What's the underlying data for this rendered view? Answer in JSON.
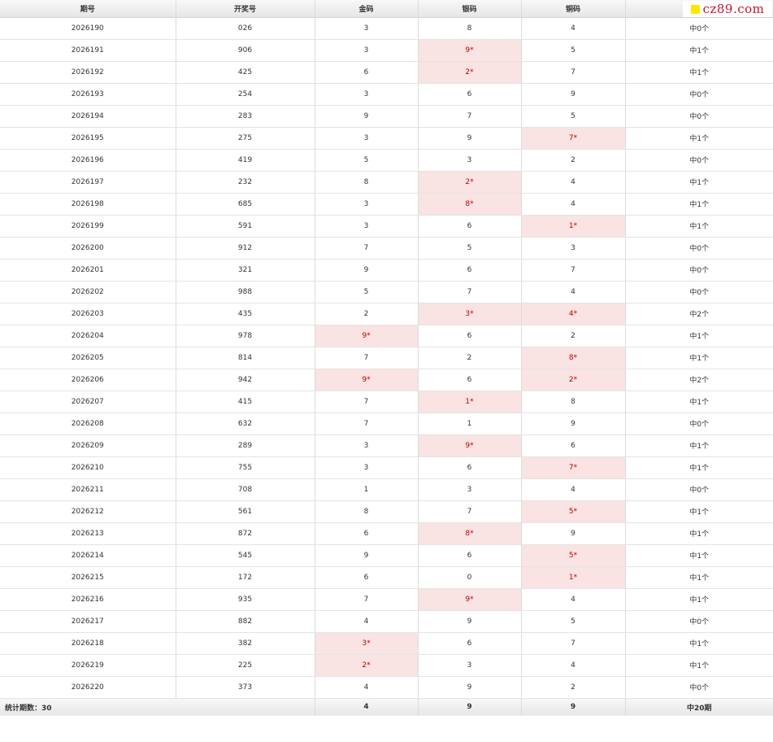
{
  "headers": [
    "期号",
    "开奖号",
    "金码",
    "银码",
    "铜码",
    ""
  ],
  "logo": {
    "text": "cz89.com",
    "color": "#c8102e",
    "square_color": "#ffe600"
  },
  "hit_color": "#fae3e3",
  "rows": [
    {
      "issue": "2026190",
      "number": "026",
      "gold": "3",
      "silver": "8",
      "bronze": "4",
      "hits": [],
      "result": "中0个"
    },
    {
      "issue": "2026191",
      "number": "906",
      "gold": "3",
      "silver": "9*",
      "bronze": "5",
      "hits": [
        "silver"
      ],
      "result": "中1个"
    },
    {
      "issue": "2026192",
      "number": "425",
      "gold": "6",
      "silver": "2*",
      "bronze": "7",
      "hits": [
        "silver"
      ],
      "result": "中1个"
    },
    {
      "issue": "2026193",
      "number": "254",
      "gold": "3",
      "silver": "6",
      "bronze": "9",
      "hits": [],
      "result": "中0个"
    },
    {
      "issue": "2026194",
      "number": "283",
      "gold": "9",
      "silver": "7",
      "bronze": "5",
      "hits": [],
      "result": "中0个"
    },
    {
      "issue": "2026195",
      "number": "275",
      "gold": "3",
      "silver": "9",
      "bronze": "7*",
      "hits": [
        "bronze"
      ],
      "result": "中1个"
    },
    {
      "issue": "2026196",
      "number": "419",
      "gold": "5",
      "silver": "3",
      "bronze": "2",
      "hits": [],
      "result": "中0个"
    },
    {
      "issue": "2026197",
      "number": "232",
      "gold": "8",
      "silver": "2*",
      "bronze": "4",
      "hits": [
        "silver"
      ],
      "result": "中1个"
    },
    {
      "issue": "2026198",
      "number": "685",
      "gold": "3",
      "silver": "8*",
      "bronze": "4",
      "hits": [
        "silver"
      ],
      "result": "中1个"
    },
    {
      "issue": "2026199",
      "number": "591",
      "gold": "3",
      "silver": "6",
      "bronze": "1*",
      "hits": [
        "bronze"
      ],
      "result": "中1个"
    },
    {
      "issue": "2026200",
      "number": "912",
      "gold": "7",
      "silver": "5",
      "bronze": "3",
      "hits": [],
      "result": "中0个"
    },
    {
      "issue": "2026201",
      "number": "321",
      "gold": "9",
      "silver": "6",
      "bronze": "7",
      "hits": [],
      "result": "中0个"
    },
    {
      "issue": "2026202",
      "number": "988",
      "gold": "5",
      "silver": "7",
      "bronze": "4",
      "hits": [],
      "result": "中0个"
    },
    {
      "issue": "2026203",
      "number": "435",
      "gold": "2",
      "silver": "3*",
      "bronze": "4*",
      "hits": [
        "silver",
        "bronze"
      ],
      "result": "中2个"
    },
    {
      "issue": "2026204",
      "number": "978",
      "gold": "9*",
      "silver": "6",
      "bronze": "2",
      "hits": [
        "gold"
      ],
      "result": "中1个"
    },
    {
      "issue": "2026205",
      "number": "814",
      "gold": "7",
      "silver": "2",
      "bronze": "8*",
      "hits": [
        "bronze"
      ],
      "result": "中1个"
    },
    {
      "issue": "2026206",
      "number": "942",
      "gold": "9*",
      "silver": "6",
      "bronze": "2*",
      "hits": [
        "gold",
        "bronze"
      ],
      "result": "中2个"
    },
    {
      "issue": "2026207",
      "number": "415",
      "gold": "7",
      "silver": "1*",
      "bronze": "8",
      "hits": [
        "silver"
      ],
      "result": "中1个"
    },
    {
      "issue": "2026208",
      "number": "632",
      "gold": "7",
      "silver": "1",
      "bronze": "9",
      "hits": [],
      "result": "中0个"
    },
    {
      "issue": "2026209",
      "number": "289",
      "gold": "3",
      "silver": "9*",
      "bronze": "6",
      "hits": [
        "silver"
      ],
      "result": "中1个"
    },
    {
      "issue": "2026210",
      "number": "755",
      "gold": "3",
      "silver": "6",
      "bronze": "7*",
      "hits": [
        "bronze"
      ],
      "result": "中1个"
    },
    {
      "issue": "2026211",
      "number": "708",
      "gold": "1",
      "silver": "3",
      "bronze": "4",
      "hits": [],
      "result": "中0个"
    },
    {
      "issue": "2026212",
      "number": "561",
      "gold": "8",
      "silver": "7",
      "bronze": "5*",
      "hits": [
        "bronze"
      ],
      "result": "中1个"
    },
    {
      "issue": "2026213",
      "number": "872",
      "gold": "6",
      "silver": "8*",
      "bronze": "9",
      "hits": [
        "silver"
      ],
      "result": "中1个"
    },
    {
      "issue": "2026214",
      "number": "545",
      "gold": "9",
      "silver": "6",
      "bronze": "5*",
      "hits": [
        "bronze"
      ],
      "result": "中1个"
    },
    {
      "issue": "2026215",
      "number": "172",
      "gold": "6",
      "silver": "0",
      "bronze": "1*",
      "hits": [
        "bronze"
      ],
      "result": "中1个"
    },
    {
      "issue": "2026216",
      "number": "935",
      "gold": "7",
      "silver": "9*",
      "bronze": "4",
      "hits": [
        "silver"
      ],
      "result": "中1个"
    },
    {
      "issue": "2026217",
      "number": "882",
      "gold": "4",
      "silver": "9",
      "bronze": "5",
      "hits": [],
      "result": "中0个"
    },
    {
      "issue": "2026218",
      "number": "382",
      "gold": "3*",
      "silver": "6",
      "bronze": "7",
      "hits": [
        "gold"
      ],
      "result": "中1个"
    },
    {
      "issue": "2026219",
      "number": "225",
      "gold": "2*",
      "silver": "3",
      "bronze": "4",
      "hits": [
        "gold"
      ],
      "result": "中1个"
    },
    {
      "issue": "2026220",
      "number": "373",
      "gold": "4",
      "silver": "9",
      "bronze": "2",
      "hits": [],
      "result": "中0个"
    }
  ],
  "footer": {
    "label": "统计期数：30",
    "gold": "4",
    "silver": "9",
    "bronze": "9",
    "result": "中20期"
  }
}
